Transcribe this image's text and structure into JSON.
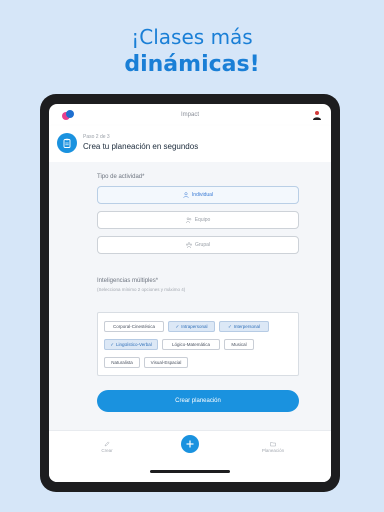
{
  "headline": {
    "line1": "¡Clases más",
    "line2": "dinámicas!"
  },
  "app": {
    "brand": "Impact"
  },
  "header": {
    "step": "Paso 2 de 3",
    "title": "Crea tu planeación en segundos"
  },
  "activity": {
    "label": "Tipo de actividad*",
    "options": [
      {
        "label": "Individual",
        "icon": "person-icon",
        "selected": true
      },
      {
        "label": "Equipo",
        "icon": "team-icon",
        "selected": false
      },
      {
        "label": "Grupal",
        "icon": "group-icon",
        "selected": false
      }
    ]
  },
  "intelligences": {
    "label": "Inteligencias múltiples*",
    "hint": "(Selecciona mínimo 2 opciones y máximo 4)",
    "chips": [
      {
        "label": "Corporal-Cinestésica",
        "selected": false
      },
      {
        "label": "Intrapersonal",
        "selected": true
      },
      {
        "label": "Interpersonal",
        "selected": true
      },
      {
        "label": "Lingüístico-Verbal",
        "selected": true
      },
      {
        "label": "Lógico-Matemática",
        "selected": false
      },
      {
        "label": "Musical",
        "selected": false
      },
      {
        "label": "Naturalista",
        "selected": false
      },
      {
        "label": "Visual-Espacial",
        "selected": false
      }
    ]
  },
  "submit_label": "Crear planeación",
  "bottom_nav": {
    "left_label": "Crear",
    "right_label": "Planeación"
  },
  "colors": {
    "accent": "#1a92df",
    "headline": "#1a7fd6",
    "background": "#d6e6f8"
  }
}
